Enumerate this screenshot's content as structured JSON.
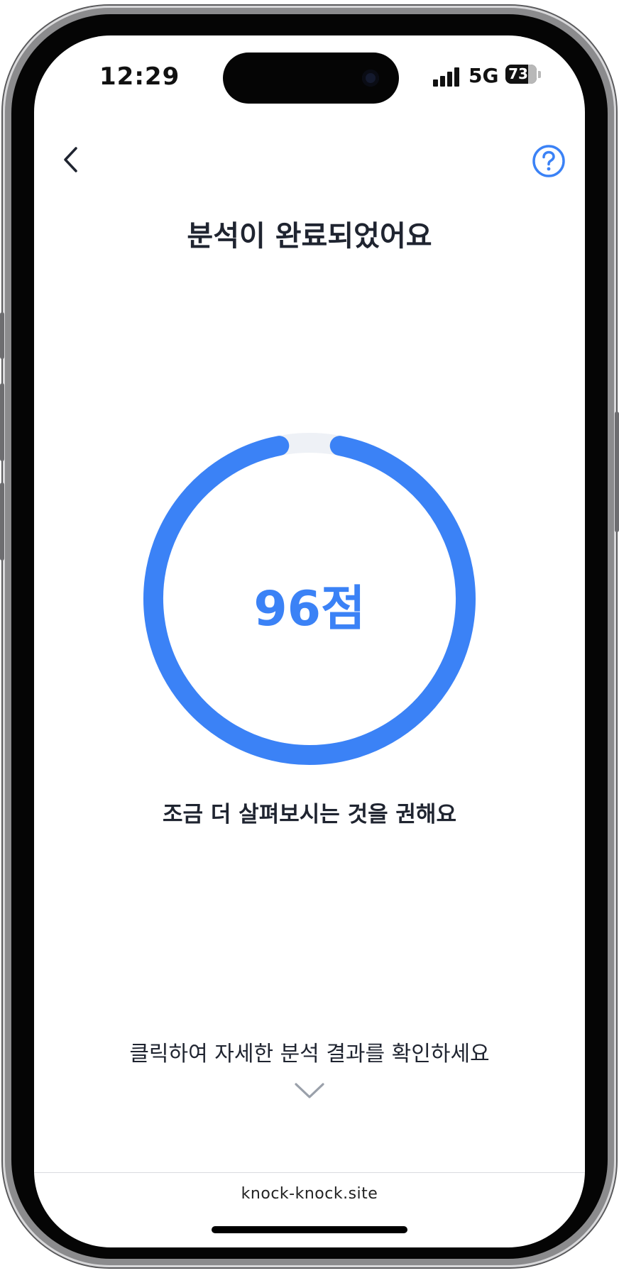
{
  "status_bar": {
    "time": "12:29",
    "network": "5G",
    "battery_percent": "73"
  },
  "header": {
    "back_icon": "chevron-left-icon",
    "help_icon": "question-circle-icon"
  },
  "main": {
    "title": "분석이 완료되었어요",
    "score_text": "96점",
    "score_value": 96,
    "score_max": 100,
    "recommendation": "조금 더 살펴보시는 것을 권해요",
    "details_prompt": "클릭하여 자세한 분석 결과를 확인하세요",
    "expand_icon": "chevron-down-icon"
  },
  "footer": {
    "site_url": "knock-knock.site"
  },
  "colors": {
    "accent": "#3b82f6",
    "ring_track": "#eef1f6",
    "text_primary": "#1f2430",
    "muted": "#9aa0aa"
  }
}
